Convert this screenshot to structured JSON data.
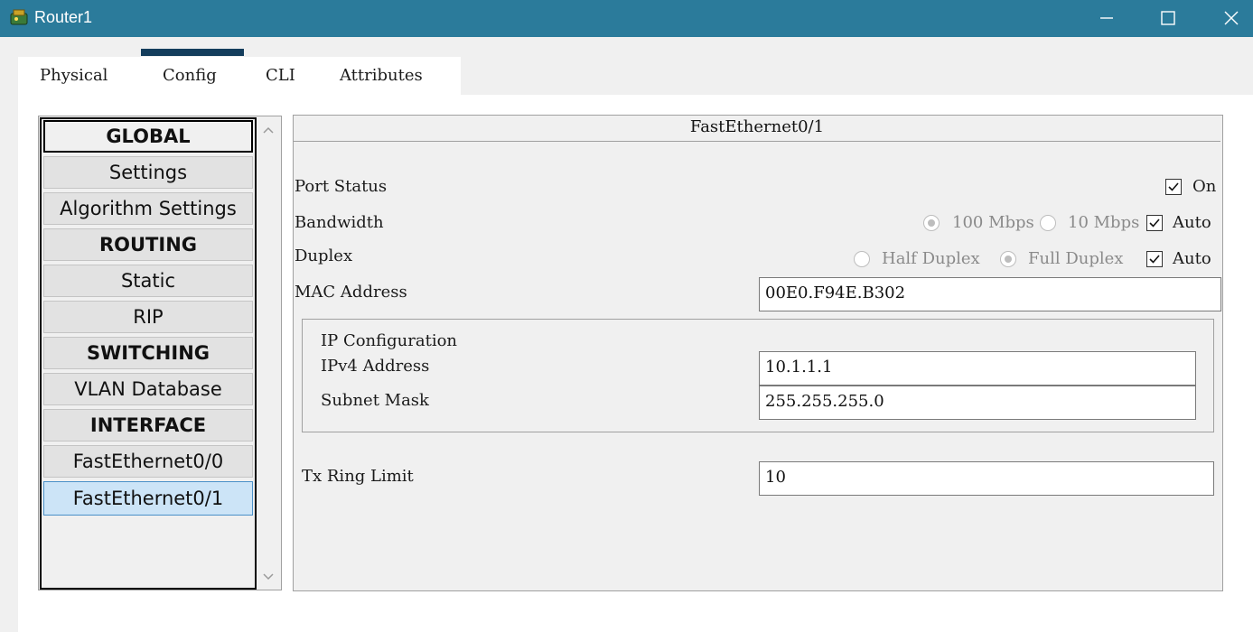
{
  "window": {
    "title": "Router1",
    "accent_color": "#2b7b9b"
  },
  "window_controls": {
    "minimize": "minimize-icon",
    "maximize": "maximize-icon",
    "close": "close-icon"
  },
  "tabs": [
    {
      "label": "Physical",
      "active": false
    },
    {
      "label": "Config",
      "active": true
    },
    {
      "label": "CLI",
      "active": false
    },
    {
      "label": "Attributes",
      "active": false
    }
  ],
  "sidebar": {
    "items": [
      {
        "label": "GLOBAL",
        "type": "header"
      },
      {
        "label": "Settings",
        "type": "item"
      },
      {
        "label": "Algorithm Settings",
        "type": "item"
      },
      {
        "label": "ROUTING",
        "type": "header"
      },
      {
        "label": "Static",
        "type": "item"
      },
      {
        "label": "RIP",
        "type": "item"
      },
      {
        "label": "SWITCHING",
        "type": "header"
      },
      {
        "label": "VLAN Database",
        "type": "item"
      },
      {
        "label": "INTERFACE",
        "type": "header"
      },
      {
        "label": "FastEthernet0/0",
        "type": "item"
      },
      {
        "label": "FastEthernet0/1",
        "type": "item",
        "selected": true
      }
    ]
  },
  "interface": {
    "title": "FastEthernet0/1",
    "port_status": {
      "label": "Port Status",
      "on_label": "On",
      "on_checked": true
    },
    "bandwidth": {
      "label": "Bandwidth",
      "option_100": "100 Mbps",
      "option_10": "10 Mbps",
      "selected": "100 Mbps",
      "auto_label": "Auto",
      "auto_checked": true
    },
    "duplex": {
      "label": "Duplex",
      "option_half": "Half Duplex",
      "option_full": "Full Duplex",
      "selected": "Full Duplex",
      "auto_label": "Auto",
      "auto_checked": true
    },
    "mac": {
      "label": "MAC Address",
      "value": "00E0.F94E.B302"
    },
    "ip_config": {
      "title": "IP Configuration",
      "ipv4_label": "IPv4 Address",
      "ipv4_value": "10.1.1.1",
      "mask_label": "Subnet Mask",
      "mask_value": "255.255.255.0"
    },
    "tx_ring": {
      "label": "Tx Ring Limit",
      "value": "10"
    }
  }
}
